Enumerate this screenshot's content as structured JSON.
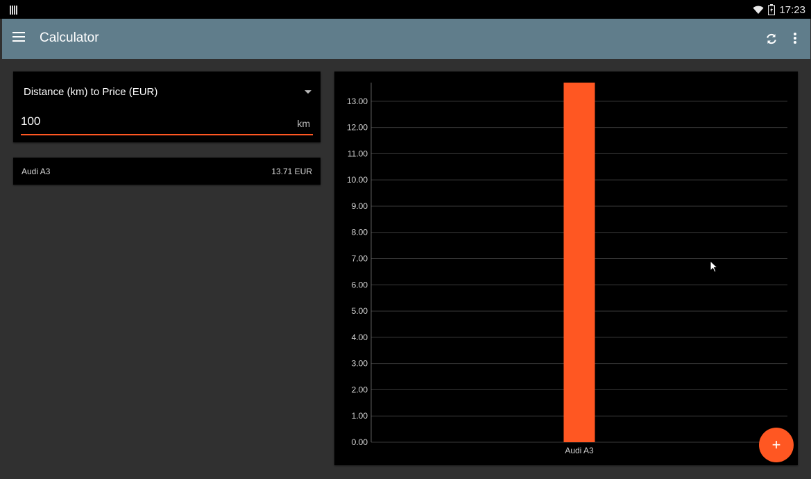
{
  "status_bar": {
    "time": "17:23"
  },
  "app_bar": {
    "title": "Calculator",
    "menu_icon": "hamburger-menu-icon",
    "refresh_icon": "refresh-icon",
    "overflow_icon": "more-vert-icon"
  },
  "converter": {
    "mode": "Distance (km) to Price (EUR)",
    "input_value": "100",
    "input_unit": "km"
  },
  "results": [
    {
      "name": "Audi A3",
      "price": "13.71 EUR"
    }
  ],
  "colors": {
    "app_bar": "#607d8b",
    "accent": "#ff5722",
    "background": "#303030",
    "card": "#000000"
  },
  "fab": {
    "icon": "add-icon",
    "label": "+"
  },
  "chart_data": {
    "type": "bar",
    "categories": [
      "Audi A3"
    ],
    "values": [
      13.71
    ],
    "ylim": [
      0,
      13.71
    ],
    "yticks": [
      "0.00",
      "1.00",
      "2.00",
      "3.00",
      "4.00",
      "5.00",
      "6.00",
      "7.00",
      "8.00",
      "9.00",
      "10.00",
      "11.00",
      "12.00",
      "13.00"
    ],
    "grid": true,
    "bar_color": "#ff5722",
    "title": "",
    "xlabel": "",
    "ylabel": ""
  }
}
